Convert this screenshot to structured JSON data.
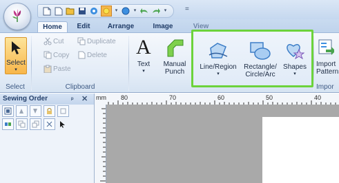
{
  "qat": {
    "extra": "="
  },
  "tabs": [
    {
      "label": "Home"
    },
    {
      "label": "Edit"
    },
    {
      "label": "Arrange"
    },
    {
      "label": "Image"
    },
    {
      "label": "View"
    }
  ],
  "ribbon": {
    "select": {
      "label": "Select",
      "group": "Select"
    },
    "clipboard": {
      "cut": "Cut",
      "copy": "Copy",
      "paste": "Paste",
      "duplicate": "Duplicate",
      "delete": "Delete",
      "group": "Clipboard"
    },
    "text": {
      "label": "Text"
    },
    "manual": {
      "line1": "Manual",
      "line2": "Punch"
    },
    "line_region": {
      "label": "Line/Region"
    },
    "rect": {
      "line1": "Rectangle/",
      "line2": "Circle/Arc"
    },
    "shapes": {
      "label": "Shapes"
    },
    "import": {
      "line1": "Import",
      "line2": "Patterns",
      "group": "Impor"
    }
  },
  "panel": {
    "title": "Sewing Order"
  },
  "ruler": {
    "top_unit": "mm",
    "ticks": [
      "80",
      "70",
      "60",
      "50",
      "40"
    ]
  },
  "colors": {
    "highlight": "#6cd33b",
    "canvas": "#a9a9a9"
  }
}
